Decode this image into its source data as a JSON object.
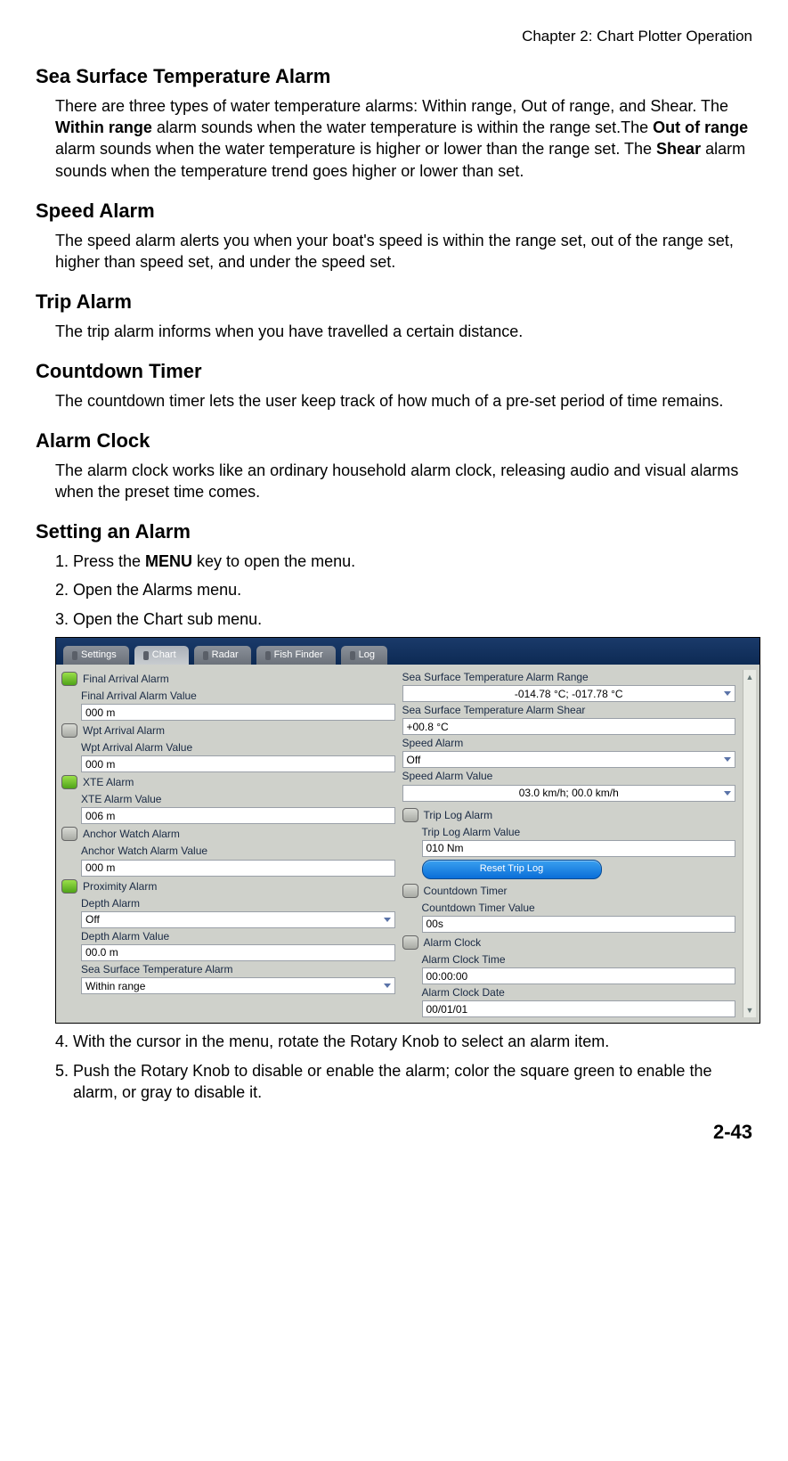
{
  "header": {
    "chapter": "Chapter 2: Chart Plotter Operation"
  },
  "sections": {
    "sst": {
      "title": "Sea Surface Temperature Alarm",
      "p1a": "There are three types of water temperature alarms: Within range, Out of range, and Shear. The ",
      "b1": "Within range",
      "p1b": " alarm sounds when the water temperature is within the range set.The ",
      "b2": "Out of range",
      "p1c": " alarm sounds when the water temperature is higher or lower than the range set. The ",
      "b3": "Shear",
      "p1d": " alarm sounds when the temperature trend goes higher or lower than set."
    },
    "speed": {
      "title": "Speed Alarm",
      "p": "The speed alarm alerts you when your boat's speed is within the range set, out of the range set, higher than speed set, and under the speed set."
    },
    "trip": {
      "title": "Trip Alarm",
      "p": "The trip alarm informs when you have travelled a certain distance."
    },
    "countdown": {
      "title": "Countdown Timer",
      "p": "The countdown timer lets the user keep track of how much of a pre-set period of time remains."
    },
    "clock": {
      "title": "Alarm Clock",
      "p": "The alarm clock works like an ordinary household alarm clock, releasing audio and visual alarms when the preset time comes."
    },
    "setting": {
      "title": "Setting an Alarm",
      "li1a": "Press the ",
      "li1b": "MENU",
      "li1c": " key to open the menu.",
      "li2": "Open the Alarms menu.",
      "li3": "Open the Chart sub menu.",
      "li4": "With the cursor in the menu, rotate the Rotary Knob to select an alarm item.",
      "li5": "Push the Rotary Knob to disable or enable the alarm; color the square green to enable the alarm, or gray to disable it."
    }
  },
  "screenshot": {
    "tabs": {
      "settings": "Settings",
      "chart": "Chart",
      "radar": "Radar",
      "fishfinder": "Fish Finder",
      "log": "Log"
    },
    "left": {
      "final_arrival": "Final Arrival Alarm",
      "final_arrival_value_label": "Final Arrival Alarm Value",
      "final_arrival_value": "000 m",
      "wpt_arrival": "Wpt Arrival Alarm",
      "wpt_arrival_value_label": "Wpt Arrival Alarm Value",
      "wpt_arrival_value": "000 m",
      "xte": "XTE Alarm",
      "xte_value_label": "XTE Alarm Value",
      "xte_value": "006 m",
      "anchor": "Anchor Watch Alarm",
      "anchor_value_label": "Anchor Watch Alarm Value",
      "anchor_value": "000 m",
      "proximity": "Proximity Alarm",
      "depth_label": "Depth Alarm",
      "depth_value": "Off",
      "depth_value_label": "Depth Alarm Value",
      "depth_value_field": "00.0 m",
      "sst_label": "Sea Surface Temperature Alarm",
      "sst_value": "Within range"
    },
    "right": {
      "sst_range_label": "Sea Surface Temperature Alarm Range",
      "sst_range_value": "-014.78 °C; -017.78 °C",
      "sst_shear_label": "Sea Surface Temperature Alarm Shear",
      "sst_shear_value": "+00.8 °C",
      "speed_label": "Speed Alarm",
      "speed_value": "Off",
      "speed_value_label": "Speed Alarm Value",
      "speed_value_field": "03.0 km/h; 00.0 km/h",
      "trip_log": "Trip Log Alarm",
      "trip_log_value_label": "Trip Log Alarm Value",
      "trip_log_value": "010 Nm",
      "reset_trip": "Reset Trip Log",
      "countdown": "Countdown Timer",
      "countdown_value_label": "Countdown Timer Value",
      "countdown_value": "00s",
      "alarm_clock": "Alarm Clock",
      "alarm_clock_time_label": "Alarm Clock Time",
      "alarm_clock_time": "00:00:00",
      "alarm_clock_date_label": "Alarm Clock Date",
      "alarm_clock_date": "00/01/01"
    }
  },
  "footer": {
    "page": "2-43"
  }
}
